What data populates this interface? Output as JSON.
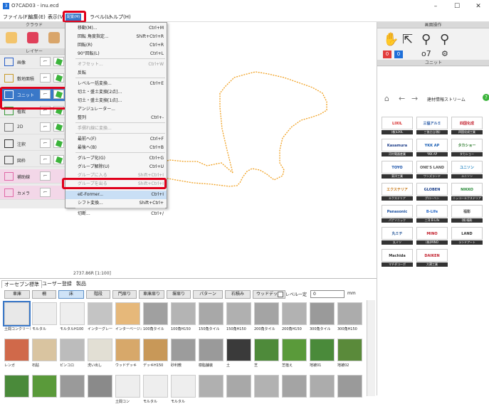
{
  "window": {
    "title": "O7CAD03 - inu.ecd",
    "icon": "app-icon",
    "minimize": "–",
    "maximize": "☐",
    "close": "✕"
  },
  "menubar": {
    "file": "ファイル(F)",
    "edit": "編集(E)",
    "view": "表示(V)",
    "active": "配置(M)",
    "label": "ラベル(L)",
    "help": "ヘルプ(H)"
  },
  "left_panel": {
    "cloud_header": "クラウド",
    "layer_header": "レイヤー",
    "layers": [
      {
        "name": "画像",
        "icon": "image-icon"
      },
      {
        "name": "敷地面積",
        "icon": "site-icon"
      },
      {
        "name": "ユニット",
        "icon": "unit-icon"
      },
      {
        "name": "植栽",
        "icon": "plant-icon"
      },
      {
        "name": "2D",
        "icon": "2d-icon"
      },
      {
        "name": "注釈",
        "icon": "annotation-icon"
      },
      {
        "name": "図枠",
        "icon": "frame-icon"
      },
      {
        "name": "補助線",
        "icon": "guide-icon"
      },
      {
        "name": "カメラ",
        "icon": "camera-icon"
      }
    ]
  },
  "dropdown": {
    "items": [
      {
        "label": "移動(M)...",
        "shortcut": "Ctrl+M",
        "disabled": false
      },
      {
        "label": "回転 角度指定...",
        "shortcut": "Shift+Ctrl+R",
        "disabled": false
      },
      {
        "label": "回転(R)",
        "shortcut": "Ctrl+R",
        "disabled": false
      },
      {
        "label": "90°回転(L)",
        "shortcut": "Ctrl+L",
        "disabled": false
      },
      {
        "label": "オフセット...",
        "shortcut": "Ctrl+W",
        "disabled": true
      },
      {
        "label": "反転",
        "shortcut": "",
        "disabled": false
      },
      {
        "label": "レベル一括変換...",
        "shortcut": "Ctrl+E",
        "disabled": false
      },
      {
        "label": "切土・盛土変換[2点]...",
        "shortcut": "",
        "disabled": false
      },
      {
        "label": "切土・盛土変換[1点]...",
        "shortcut": "",
        "disabled": false
      },
      {
        "label": "アンジュレーター...",
        "shortcut": "",
        "disabled": false
      },
      {
        "label": "整列",
        "shortcut": "Ctrl+-",
        "disabled": false
      },
      {
        "label": "手摺れ線に変換...",
        "shortcut": "",
        "disabled": true
      },
      {
        "label": "最前へ(F)",
        "shortcut": "Ctrl+F",
        "disabled": false
      },
      {
        "label": "最後へ(B)",
        "shortcut": "Ctrl+B",
        "disabled": false
      },
      {
        "label": "グループ化(G)",
        "shortcut": "Ctrl+G",
        "disabled": false
      },
      {
        "label": "グループ解除(U)",
        "shortcut": "Ctrl+U",
        "disabled": false
      },
      {
        "label": "グループに入る",
        "shortcut": "Shift+Ctrl+I",
        "disabled": true
      },
      {
        "label": "グループを出る",
        "shortcut": "Shift+Ctrl+I",
        "disabled": true
      },
      {
        "label": "eE-Former...",
        "shortcut": "Ctrl+I",
        "disabled": false
      },
      {
        "label": "シフト変換...",
        "shortcut": "Shift+Ctrl+",
        "disabled": false
      },
      {
        "label": "切断...",
        "shortcut": "Ctrl+/",
        "disabled": false
      }
    ]
  },
  "status": {
    "coords": "2737.86R [1:100]"
  },
  "right_panel": {
    "ops_header": "画面操作",
    "unit_header": "ユニット",
    "counter1": "0",
    "counter2": "0",
    "stream_title": "建材情報ストリーム",
    "brands": [
      {
        "name": "LIXIL",
        "cap": "(株)LIXIL",
        "color": "#d62a2a"
      },
      {
        "name": "三協アルミ",
        "cap": "三協立山(株)",
        "color": "#1a4fa0"
      },
      {
        "name": "四国化成",
        "cap": "四国化成工業",
        "color": "#c21f2c"
      },
      {
        "name": "Kasamura",
        "cap": "河村電器産業",
        "color": "#1e3f8a"
      },
      {
        "name": "YKK AP",
        "cap": "YKK AP",
        "color": "#1a5fb4"
      },
      {
        "name": "タカショー",
        "cap": "タカショー",
        "color": "#2a7a2a"
      },
      {
        "name": "TOYO",
        "cap": "東洋工業",
        "color": "#1650a8"
      },
      {
        "name": "ONE'S LAND",
        "cap": "ワンズランド",
        "color": "#555555"
      },
      {
        "name": "ユニソン",
        "cap": "ユニソン",
        "color": "#1a80c0"
      },
      {
        "name": "エクステリア",
        "cap": "エクステリア",
        "color": "#c87a1a"
      },
      {
        "name": "GLOBEN",
        "cap": "グローベン",
        "color": "#1a3f8a"
      },
      {
        "name": "NIKKO",
        "cap": "ニッコーエクステリア",
        "color": "#2a8a3a"
      },
      {
        "name": "Panasonic",
        "cap": "パナソニック",
        "color": "#1a4fa0"
      },
      {
        "name": "B-Life",
        "cap": "三洋 B-Life",
        "color": "#2a6ac8"
      },
      {
        "name": "福彫",
        "cap": "(株)福彫",
        "color": "#555555"
      },
      {
        "name": "丸ミチ",
        "cap": "丸ミツ",
        "color": "#2a5a9a"
      },
      {
        "name": "MINO",
        "cap": "(株)MINO",
        "color": "#c21f2c"
      },
      {
        "name": "LAND",
        "cap": "ランドアート",
        "color": "#333333"
      },
      {
        "name": "Machida",
        "cap": "マチダコーポ",
        "color": "#333333"
      },
      {
        "name": "DAIKEN",
        "cap": "大建工業",
        "color": "#c21f2c"
      }
    ]
  },
  "bottom_panel": {
    "tabs": [
      "オーセブン標準",
      "ユーザー登録",
      "製品"
    ],
    "filters": [
      "車庫",
      "柵",
      "床",
      "階段",
      "門扉り",
      "車庫扉り",
      "塀扉り",
      "パターン",
      "石積み",
      "ウッドデッキ"
    ],
    "level_label": "レベル一定",
    "level_value": "0",
    "level_unit": "mm",
    "tiles_row1": [
      {
        "label": "土間コンクリート",
        "color": "#e8e8e8"
      },
      {
        "label": "モルタル",
        "color": "#eeeeee"
      },
      {
        "label": "モルタルH100",
        "color": "#eeeeee"
      },
      {
        "label": "インターグレー",
        "color": "#c4c4c4"
      },
      {
        "label": "インターベージュ",
        "color": "#e6b87a"
      },
      {
        "label": "100角タイル",
        "color": "#a0a0a0"
      },
      {
        "label": "100角H150",
        "color": "#b4b4b4"
      },
      {
        "label": "150角タイル",
        "color": "#a8a8a8"
      },
      {
        "label": "150角H150",
        "color": "#b0b0b0"
      },
      {
        "label": "200角タイル",
        "color": "#a4a4a4"
      },
      {
        "label": "200角H150",
        "color": "#b2b2b2"
      },
      {
        "label": "300角タイル",
        "color": "#9a9a9a"
      },
      {
        "label": "300角H150",
        "color": "#acacac"
      }
    ],
    "tiles_row2": [
      {
        "label": "レンガ",
        "color": "#d0694a"
      },
      {
        "label": "石貼",
        "color": "#d9c4a0"
      },
      {
        "label": "ピンコロ",
        "color": "#bcbcbc"
      },
      {
        "label": "洗い出し",
        "color": "#e2dfd4"
      },
      {
        "label": "ウッドデッキ",
        "color": "#d7a86a"
      },
      {
        "label": "デッキH150",
        "color": "#c89858"
      },
      {
        "label": "砂利敷",
        "color": "#9c9c9c"
      },
      {
        "label": "樹脂舗装",
        "color": "#9a9a9a"
      },
      {
        "label": "土",
        "color": "#3a3a3a"
      },
      {
        "label": "芝",
        "color": "#4e8a3a"
      },
      {
        "label": "芝植え",
        "color": "#5a9a3a"
      },
      {
        "label": "地被01",
        "color": "#4a8a3a"
      },
      {
        "label": "地被02",
        "color": "#5a8a3a"
      }
    ],
    "tiles_row3": [
      {
        "label": "",
        "color": "#4a8a3a"
      },
      {
        "label": "",
        "color": "#5a9a3a"
      },
      {
        "label": "",
        "color": "#9a9a9a"
      },
      {
        "label": "",
        "color": "#8a8a8a"
      },
      {
        "label": "土間コン",
        "color": "#eeeeee"
      },
      {
        "label": "モルタル",
        "color": "#eeeeee"
      },
      {
        "label": "モルタル",
        "color": "#eeeeee"
      },
      {
        "label": "",
        "color": "#b0b0b0"
      },
      {
        "label": "",
        "color": "#a8a8a8"
      },
      {
        "label": "",
        "color": "#b2b2b2"
      },
      {
        "label": "",
        "color": "#a4a4a4"
      },
      {
        "label": "",
        "color": "#acacac"
      },
      {
        "label": "",
        "color": "#9a9a9a"
      }
    ]
  },
  "colors": {
    "accent": "#3a78c8",
    "highlight_red": "#e0001b",
    "drawing": "#f0a020"
  }
}
